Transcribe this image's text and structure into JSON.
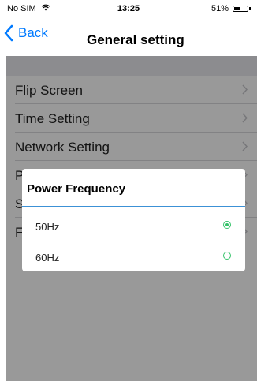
{
  "status_bar": {
    "carrier": "No SIM",
    "time": "13:25",
    "battery": "51%",
    "battery_level": 0.51,
    "wifi_icon": "wifi-icon"
  },
  "nav": {
    "back_label": "Back",
    "title": "General setting"
  },
  "settings": {
    "items": [
      {
        "label": "Flip Screen"
      },
      {
        "label": "Time Setting"
      },
      {
        "label": "Network Setting"
      },
      {
        "label": "P"
      },
      {
        "label": "S"
      },
      {
        "label": "F"
      }
    ]
  },
  "dialog": {
    "title": "Power Frequency",
    "options": [
      {
        "label": "50Hz",
        "selected": true
      },
      {
        "label": "60Hz",
        "selected": false
      }
    ]
  },
  "colors": {
    "accent": "#007aff",
    "radio": "#35c36a",
    "divider": "#3c91d6"
  }
}
